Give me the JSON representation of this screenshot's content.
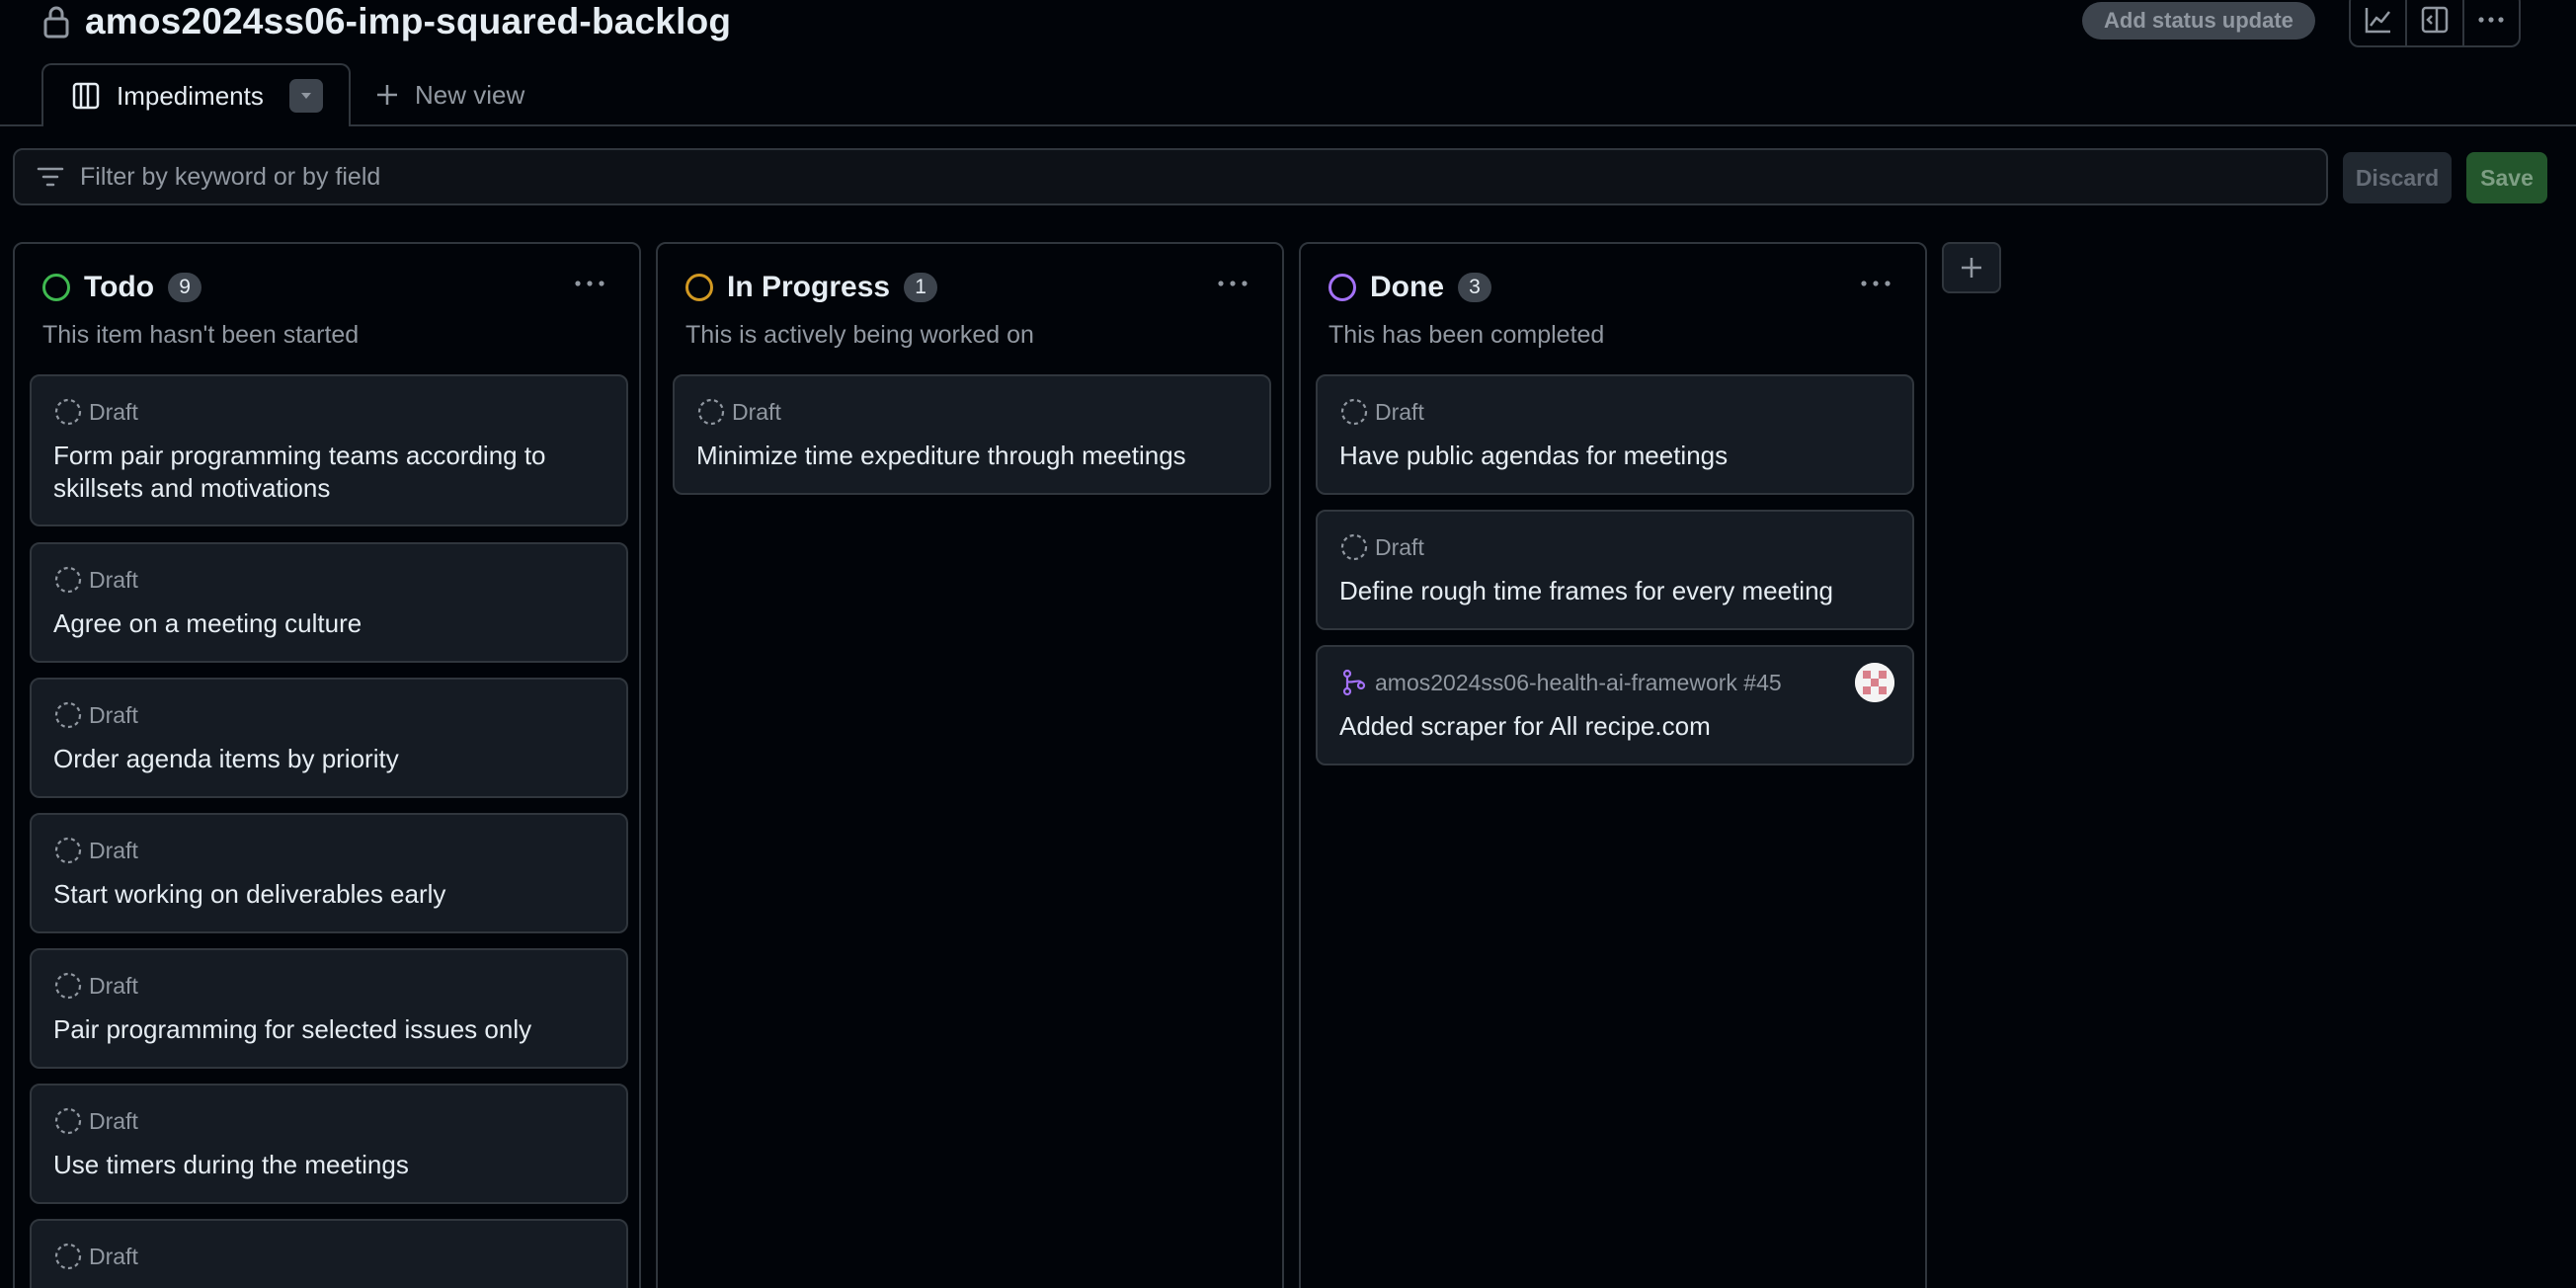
{
  "project": {
    "title": "amos2024ss06-imp-squared-backlog"
  },
  "header": {
    "status_update_label": "Add status update",
    "icons": [
      "insights-icon",
      "side-panel-icon",
      "more-options-icon"
    ]
  },
  "views": {
    "tabs": [
      {
        "label": "Impediments",
        "icon": "board-icon"
      }
    ],
    "new_view_label": "New view"
  },
  "filter": {
    "placeholder": "Filter by keyword or by field",
    "value": "",
    "discard_label": "Discard",
    "save_label": "Save"
  },
  "colors": {
    "todo": "#3fb950",
    "in_progress": "#d29922",
    "done": "#a371f7",
    "save": "#238636"
  },
  "columns": [
    {
      "title": "Todo",
      "count": "9",
      "description": "This item hasn't been started",
      "cards": [
        {
          "meta": "Draft",
          "title": "Form pair programming teams according to skillsets and motivations"
        },
        {
          "meta": "Draft",
          "title": "Agree on a meeting culture"
        },
        {
          "meta": "Draft",
          "title": "Order agenda items by priority"
        },
        {
          "meta": "Draft",
          "title": "Start working on deliverables early"
        },
        {
          "meta": "Draft",
          "title": "Pair programming for selected issues only"
        },
        {
          "meta": "Draft",
          "title": "Use timers during the meetings"
        },
        {
          "meta": "Draft",
          "title": ""
        }
      ]
    },
    {
      "title": "In Progress",
      "count": "1",
      "description": "This is actively being worked on",
      "cards": [
        {
          "meta": "Draft",
          "title": "Minimize time expediture through meetings"
        }
      ]
    },
    {
      "title": "Done",
      "count": "3",
      "description": "This has been completed",
      "cards": [
        {
          "meta": "Draft",
          "title": "Have public agendas for meetings"
        },
        {
          "meta": "Draft",
          "title": "Define rough time frames for every meeting"
        },
        {
          "meta": "amos2024ss06-health-ai-framework #45",
          "title": "Added scraper for All recipe.com",
          "icon": "pull-request-icon"
        }
      ]
    }
  ]
}
